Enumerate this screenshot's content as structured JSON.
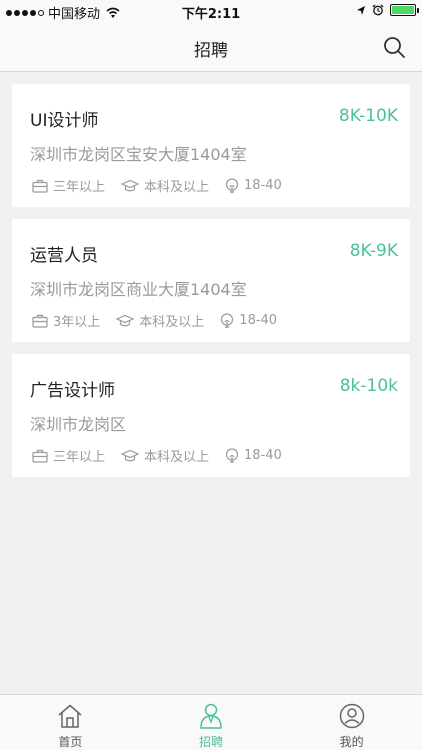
{
  "status_bar": {
    "carrier": "中国移动",
    "time": "下午2:11",
    "icons": [
      "signal-dots-icon",
      "wifi-icon",
      "location-icon",
      "alarm-icon",
      "battery-icon"
    ],
    "battery_level": 1.0
  },
  "nav": {
    "title": "招聘",
    "search_icon": "search-icon"
  },
  "jobs": [
    {
      "title": "UI设计师",
      "salary": "8K-10K",
      "address": "深圳市龙岗区宝安大厦1404室",
      "experience": "三年以上",
      "education": "本科及以上",
      "age": "18-40"
    },
    {
      "title": "运营人员",
      "salary": "8K-9K",
      "address": "深圳市龙岗区商业大厦1404室",
      "experience": "3年以上",
      "education": "本科及以上",
      "age": "18-40"
    },
    {
      "title": "广告设计师",
      "salary": "8k-10k",
      "address": "深圳市龙岗区",
      "experience": "三年以上",
      "education": "本科及以上",
      "age": "18-40"
    }
  ],
  "tabs": [
    {
      "label": "首页",
      "icon": "home-icon",
      "active": false
    },
    {
      "label": "招聘",
      "icon": "recruit-person-icon",
      "active": true
    },
    {
      "label": "我的",
      "icon": "profile-icon",
      "active": false
    }
  ],
  "colors": {
    "accent": "#4dbf9c",
    "muted": "#9a9a9a",
    "background": "#f1f1f1"
  }
}
